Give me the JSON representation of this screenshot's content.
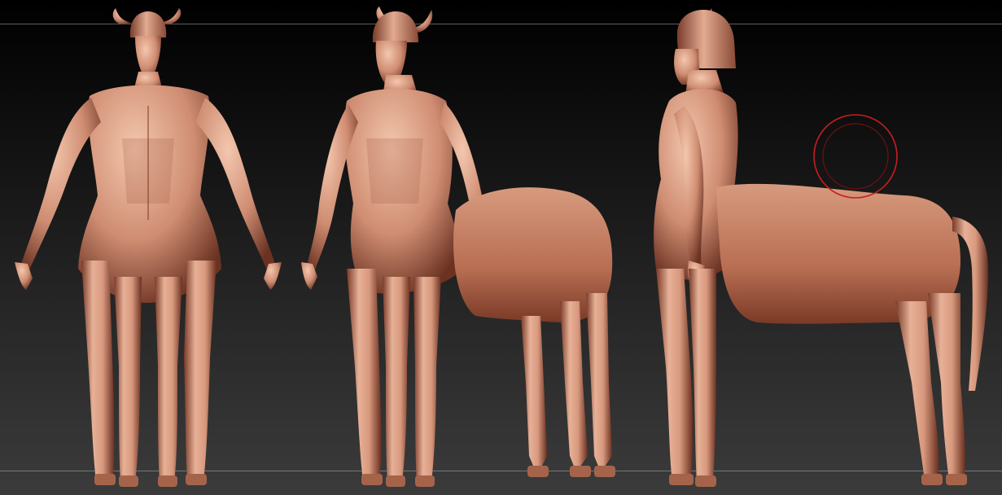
{
  "app": {
    "type": "3d-sculpting-viewport"
  },
  "viewport": {
    "background_top": "#000000",
    "background_bottom": "#3b3b3b",
    "guide_line_color": "#aaaaaa"
  },
  "models": [
    {
      "name_icon": "centaur-front-view-model",
      "view": "front"
    },
    {
      "name_icon": "centaur-three-quarter-view-model",
      "view": "three-quarter"
    },
    {
      "name_icon": "centaur-side-view-model",
      "view": "side"
    }
  ],
  "material": {
    "skin_light": "#f0c0a6",
    "skin_mid": "#c7846a",
    "skin_dark": "#5a2a1c"
  },
  "brush": {
    "outer_color": "#c81e1e",
    "inner_color": "#6e1010",
    "icon": "brush-cursor-ring"
  }
}
